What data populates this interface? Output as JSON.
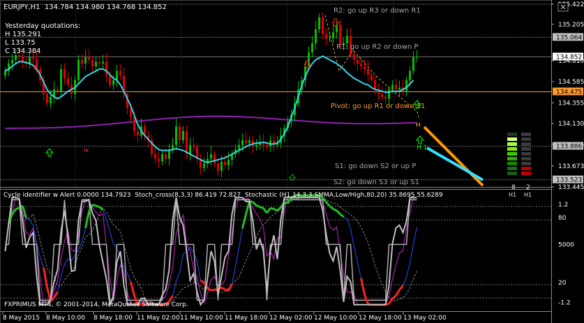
{
  "window": {
    "symbol_title": "EURJPY,H1  134.784 134.980 134.768 134.852",
    "yesterday_label": "Yesterday quotations:",
    "yesterday_high": "H 135.291",
    "yesterday_low": "L 133.75",
    "yesterday_close": "C 134.384",
    "copyright": "FXPRIMUS MT4, © 2001-2014, MetaQuotes Software Corp."
  },
  "pivot_labels": {
    "r2": "R2: go up R3 or down R1",
    "r1": "R1: go up R2 or down P",
    "pivot": "Pivot: go up R1 or down S1",
    "s1": "S1: go down S2 or up P",
    "s2": "S2: go down S3 or up S1"
  },
  "colors": {
    "background": "#000000",
    "bull_candle": "#00c000",
    "bear_candle": "#e00000",
    "ma_fast": "#33d6f0",
    "ma_slow": "#9020b0",
    "pivot_line": "#ff9a2e",
    "grid": "#555555",
    "trend_orange": "#ff9900",
    "trend_cyan": "#33e0ff"
  },
  "price_axis": {
    "ticks": [
      "135.422",
      "135.205",
      "134.810",
      "134.585",
      "134.355",
      "134.130",
      "133.905",
      "133.673",
      "133.445"
    ],
    "markers": [
      {
        "label": "135.064",
        "bg": "#c0c0c0",
        "fg": "#000000",
        "value": 135.064
      },
      {
        "label": "134.852",
        "bg": "#ffffff",
        "fg": "#000000",
        "value": 134.852
      },
      {
        "label": "134.475",
        "bg": "#ff9a2e",
        "fg": "#000000",
        "value": 134.475
      },
      {
        "label": "133.886",
        "bg": "#c0c0c0",
        "fg": "#000000",
        "value": 133.886
      },
      {
        "label": "133.523",
        "bg": "#c0c0c0",
        "fg": "#000000",
        "value": 133.523
      }
    ]
  },
  "time_axis": [
    "8 May 2015",
    "8 May 10:00",
    "8 May 18:00",
    "11 May 02:00",
    "11 May 10:00",
    "11 May 18:00",
    "12 May 02:00",
    "12 May 10:00",
    "12 May 18:00",
    "13 May 02:00"
  ],
  "strength_meter": {
    "left_label": "8",
    "right_label": "2",
    "left_tf": "H1",
    "right_tf": "H1",
    "left_green_bars": 8,
    "right_red_bars": 2
  },
  "signals": {
    "h_label": "H",
    "h1_label": "H 1"
  },
  "sub_window": {
    "header": "Cycle identifier w Alert 0.0000 134.7923  Stoch_cross(8,3,3) 86.419 72.827  Stochastic (H1,14,3,3,SMMA,Low/High,80,20) 35.8695 55.6289",
    "ticks": [
      "1.2",
      "80",
      "5000",
      "20",
      "-1.2"
    ]
  },
  "chart_data": {
    "type": "candlestick",
    "symbol": "EURJPY",
    "timeframe": "H1",
    "ylim": [
      133.445,
      135.422
    ],
    "ohlc_last": {
      "open": 134.784,
      "high": 134.98,
      "low": 134.768,
      "close": 134.852
    },
    "levels": {
      "R2": 135.422,
      "R1": 135.064,
      "Pivot": 134.475,
      "S1": 133.886,
      "S2": 133.523
    },
    "closes": [
      134.7,
      134.78,
      134.82,
      134.87,
      134.86,
      134.8,
      134.78,
      134.85,
      134.83,
      134.72,
      134.6,
      134.45,
      134.35,
      134.42,
      134.5,
      134.48,
      134.72,
      134.62,
      134.55,
      134.45,
      134.6,
      134.82,
      134.78,
      134.85,
      134.82,
      134.75,
      134.8,
      134.78,
      134.8,
      134.65,
      134.55,
      134.6,
      134.7,
      134.65,
      134.45,
      134.3,
      134.2,
      134.05,
      134.0,
      134.1,
      134.0,
      133.95,
      133.8,
      133.75,
      133.72,
      133.8,
      133.75,
      133.85,
      133.9,
      134.1,
      133.95,
      134.05,
      133.8,
      133.9,
      133.88,
      133.75,
      133.65,
      133.7,
      133.75,
      133.8,
      133.7,
      133.62,
      133.72,
      133.68,
      133.74,
      133.8,
      133.85,
      133.9,
      133.95,
      133.92,
      133.95,
      133.88,
      133.9,
      133.93,
      133.9,
      133.88,
      133.95,
      133.9,
      133.92,
      134.0,
      134.08,
      134.15,
      134.22,
      134.35,
      134.5,
      134.6,
      134.75,
      134.9,
      135.0,
      135.15,
      135.28,
      135.1,
      135.05,
      135.05,
      135.12,
      135.2,
      134.98,
      135.0,
      135.08,
      134.88,
      134.82,
      134.78,
      134.75,
      134.72,
      134.66,
      134.6,
      134.5,
      134.45,
      134.42,
      134.4,
      134.5,
      134.55,
      134.5,
      134.52,
      134.48,
      134.6,
      134.7,
      134.85,
      134.852
    ],
    "ma_fast": [
      134.7,
      134.72,
      134.75,
      134.78,
      134.8,
      134.8,
      134.79,
      134.78,
      134.76,
      134.72,
      134.66,
      134.58,
      134.5,
      134.45,
      134.42,
      134.4,
      134.42,
      134.45,
      134.48,
      134.5,
      134.52,
      134.56,
      134.6,
      134.64,
      134.66,
      134.68,
      134.7,
      134.72,
      134.72,
      134.7,
      134.66,
      134.62,
      134.6,
      134.55,
      134.48,
      134.4,
      134.32,
      134.22,
      134.12,
      134.05,
      134.0,
      133.96,
      133.92,
      133.88,
      133.85,
      133.84,
      133.84,
      133.84,
      133.85,
      133.86,
      133.85,
      133.84,
      133.82,
      133.8,
      133.78,
      133.76,
      133.74,
      133.72,
      133.71,
      133.72,
      133.73,
      133.74,
      133.75,
      133.76,
      133.78,
      133.8,
      133.82,
      133.84,
      133.86,
      133.88,
      133.9,
      133.91,
      133.92,
      133.92,
      133.93,
      133.92,
      133.91,
      133.91,
      133.92,
      133.96,
      134.02,
      134.1,
      134.2,
      134.3,
      134.42,
      134.54,
      134.64,
      134.72,
      134.78,
      134.82,
      134.84,
      134.86,
      134.84,
      134.82,
      134.8,
      134.78,
      134.75,
      134.72,
      134.68,
      134.65,
      134.62,
      134.6,
      134.58,
      134.56,
      134.55,
      134.52,
      134.5,
      134.49,
      134.48,
      134.47,
      134.47,
      134.48,
      134.48,
      134.48,
      134.5,
      134.52,
      134.56,
      134.6
    ],
    "ma_slow_start": 134.08,
    "ma_slow_end": 134.16
  }
}
